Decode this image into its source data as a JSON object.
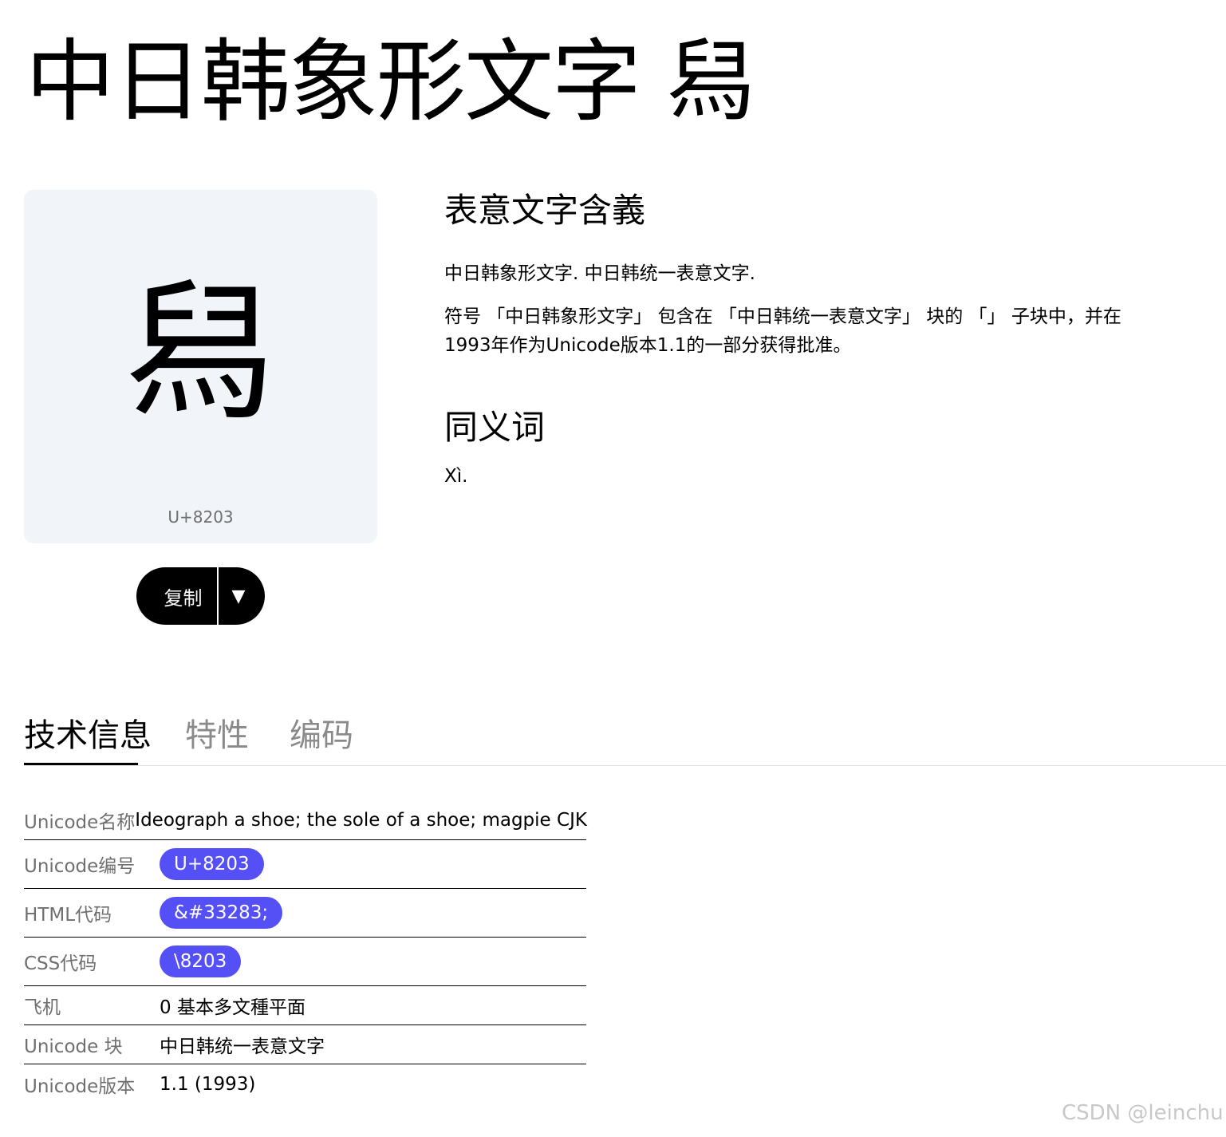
{
  "page": {
    "title": "中日韩象形文字 舄"
  },
  "glyph": {
    "character": "舄",
    "codepoint": "U+8203"
  },
  "actions": {
    "copy_label": "复制",
    "dropdown_glyph": "▼"
  },
  "meaning": {
    "heading": "表意文字含義",
    "paragraph1": "中日韩象形文字. 中日韩统一表意文字.",
    "paragraph2": "符号 「中日韩象形文字」 包含在 「中日韩统一表意文字」 块的 「」 子块中，并在1993年作为Unicode版本1.1的一部分获得批准。"
  },
  "synonyms": {
    "heading": "同义词",
    "value": "Xì."
  },
  "tabs": [
    {
      "label": "技术信息",
      "active": true
    },
    {
      "label": "特性",
      "active": false
    },
    {
      "label": "编码",
      "active": false
    }
  ],
  "info": {
    "unicode_name": {
      "label": "Unicode名称",
      "value": "Ideograph a shoe; the sole of a shoe; magpie CJK"
    },
    "unicode_number": {
      "label": "Unicode编号",
      "value": "U+8203"
    },
    "html_code": {
      "label": "HTML代码",
      "value": "&#33283;"
    },
    "css_code": {
      "label": "CSS代码",
      "value": "\\8203"
    },
    "plane": {
      "label": "飞机",
      "value": "0 基本多文種平面"
    },
    "unicode_block": {
      "label": "Unicode 块",
      "value": "中日韩统一表意文字"
    },
    "unicode_version": {
      "label": "Unicode版本",
      "value": "1.1 (1993)"
    }
  },
  "watermark": "CSDN @leinchu",
  "colors": {
    "accent_pill": "#5550f5",
    "card_background": "#f1f4f9",
    "button_background": "#000000"
  }
}
